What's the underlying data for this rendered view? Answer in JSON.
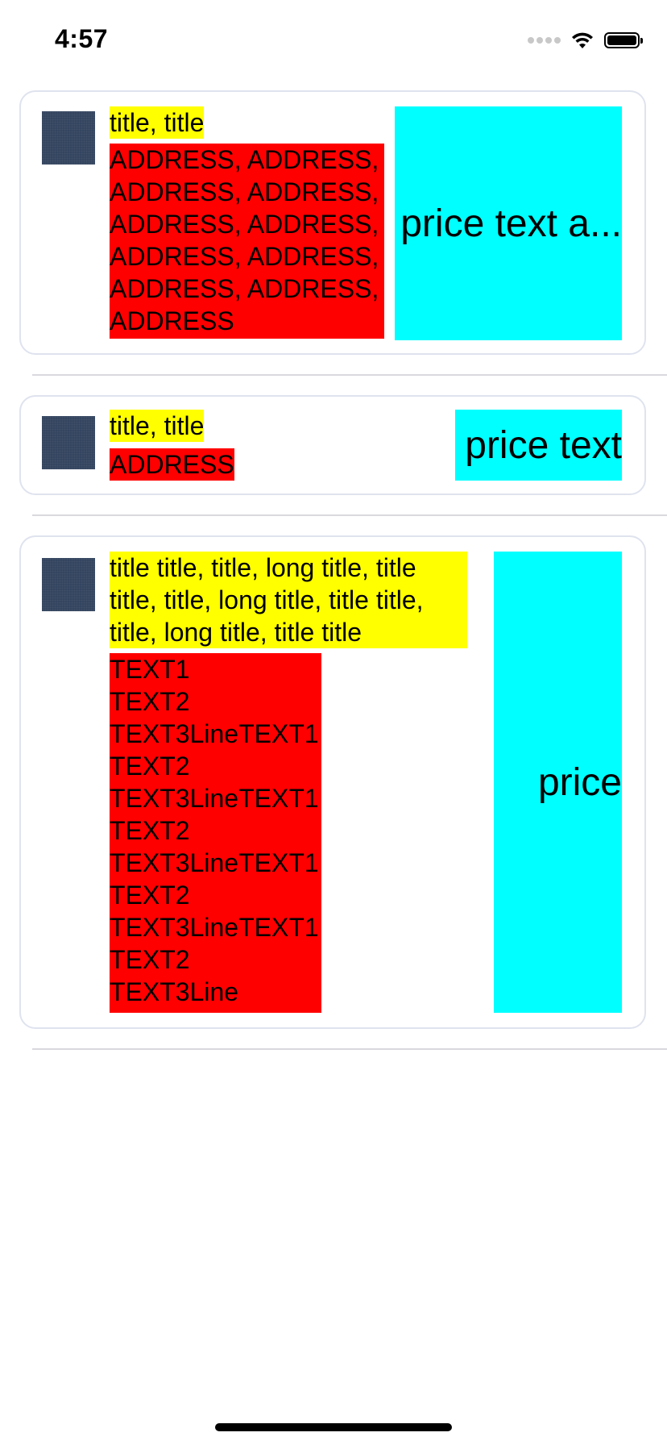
{
  "status_bar": {
    "time": "4:57",
    "battery_level": 1.0,
    "icons": [
      "signal-dots-icon",
      "wifi-icon",
      "battery-icon"
    ]
  },
  "colors": {
    "title_bg": "#ffff00",
    "address_bg": "#ff0000",
    "price_bg": "#00ffff",
    "thumb": "#344560"
  },
  "cards": [
    {
      "title": "title, title",
      "address": "ADDRESS, ADDRESS,\nADDRESS, ADDRESS,\nADDRESS, ADDRESS,\nADDRESS, ADDRESS,\nADDRESS, ADDRESS,\nADDRESS",
      "price": "price text a..."
    },
    {
      "title": "title, title",
      "address": "ADDRESS",
      "price": "price text"
    },
    {
      "title": "title title, title, long title, title\ntitle, title, long title, title title,\ntitle, long title, title title",
      "address": "TEXT1\nTEXT2\nTEXT3LineTEXT1\nTEXT2\nTEXT3LineTEXT1\nTEXT2\nTEXT3LineTEXT1\nTEXT2\nTEXT3LineTEXT1\nTEXT2\nTEXT3Line",
      "price": "price"
    }
  ]
}
